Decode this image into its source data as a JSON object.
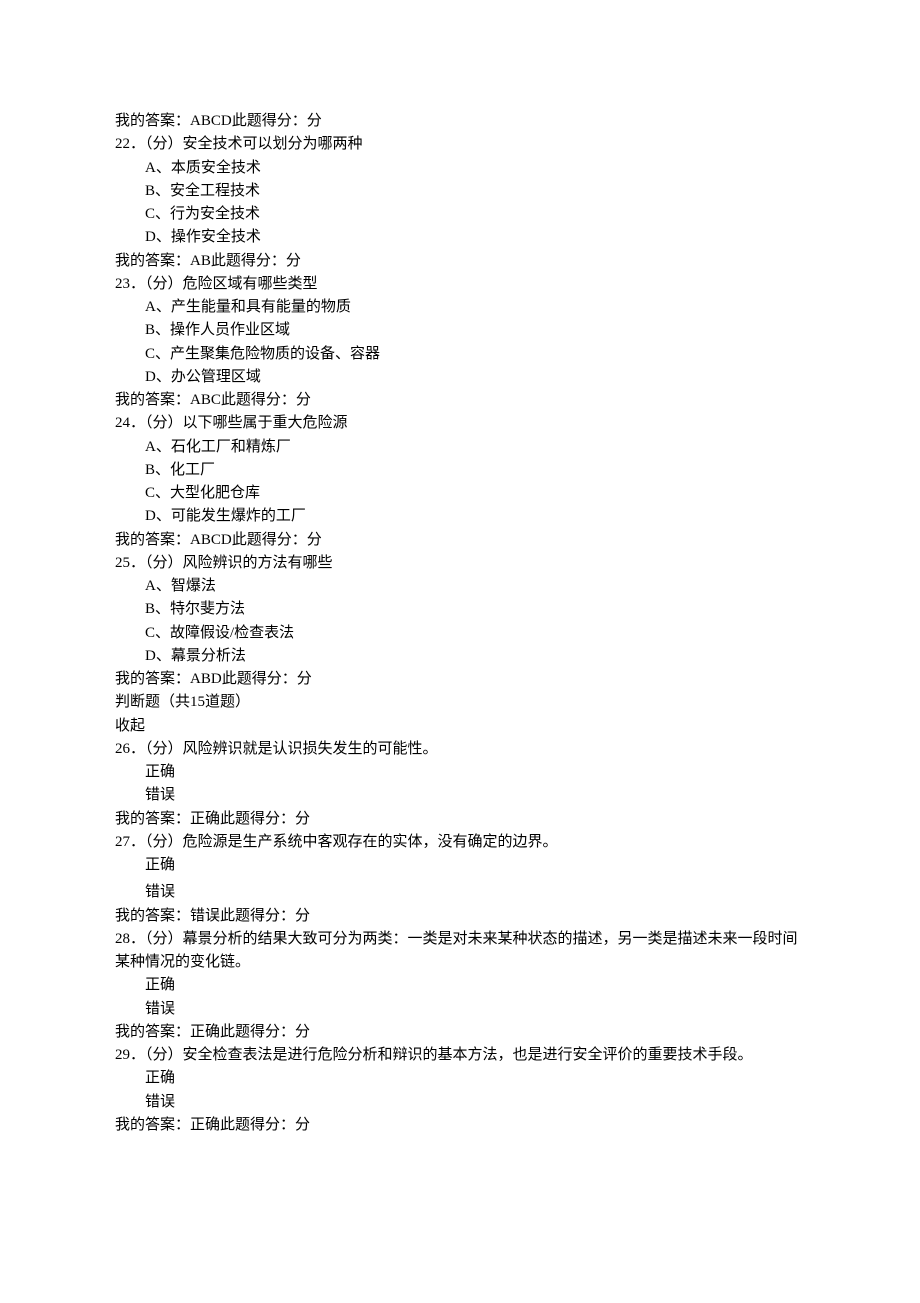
{
  "labels": {
    "my_answer_prefix": "我的答案：",
    "score_suffix": "此题得分：分",
    "q_prefix": "．（分）",
    "section_tf": "判断题（共15道题）",
    "collapse": "收起",
    "correct": "正确",
    "wrong": "错误"
  },
  "lead_answer": "ABCD",
  "questions": [
    {
      "num": "22",
      "text": "安全技术可以划分为哪两种",
      "opts": [
        "A、本质安全技术",
        "B、安全工程技术",
        "C、行为安全技术",
        "D、操作安全技术"
      ],
      "answer": "AB"
    },
    {
      "num": "23",
      "text": "危险区域有哪些类型",
      "opts": [
        "A、产生能量和具有能量的物质",
        "B、操作人员作业区域",
        "C、产生聚集危险物质的设备、容器",
        "D、办公管理区域"
      ],
      "answer": "ABC"
    },
    {
      "num": "24",
      "text": "以下哪些属于重大危险源",
      "opts": [
        "A、石化工厂和精炼厂",
        "B、化工厂",
        "C、大型化肥仓库",
        "D、可能发生爆炸的工厂"
      ],
      "answer": "ABCD"
    },
    {
      "num": "25",
      "text": "风险辨识的方法有哪些",
      "opts": [
        "A、智爆法",
        "B、特尔斐方法",
        "C、故障假设/检查表法",
        "D、幕景分析法"
      ],
      "answer": "ABD"
    }
  ],
  "tf_questions": [
    {
      "num": "26",
      "text": "风险辨识就是认识损失发生的可能性。",
      "answer": "正确"
    },
    {
      "num": "27",
      "text": "危险源是生产系统中客观存在的实体，没有确定的边界。",
      "answer": "错误"
    },
    {
      "num": "28",
      "text": "幕景分析的结果大致可分为两类：一类是对未来某种状态的描述，另一类是描述未来一段时间某种情况的变化链。",
      "answer": "正确"
    },
    {
      "num": "29",
      "text": "安全检查表法是进行危险分析和辩识的基本方法，也是进行安全评价的重要技术手段。",
      "answer": "正确"
    }
  ]
}
